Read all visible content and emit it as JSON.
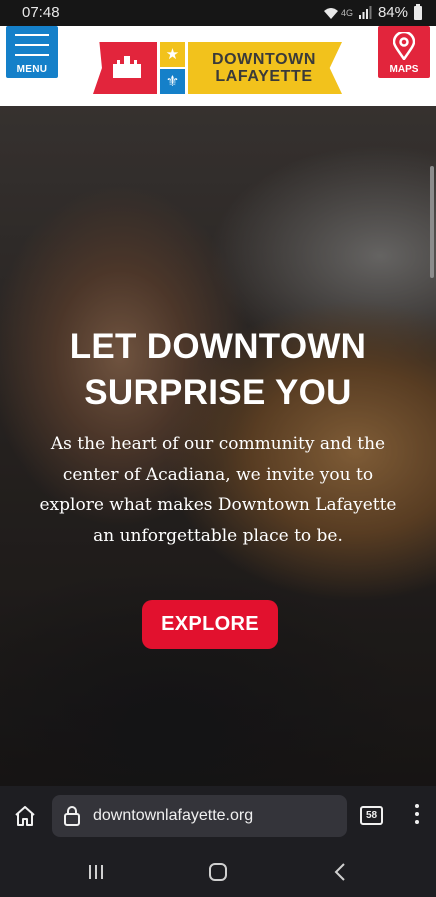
{
  "status_bar": {
    "time": "07:48",
    "network": "4G",
    "battery": "84%"
  },
  "header": {
    "menu_label": "MENU",
    "logo_text_line1": "DOWNTOWN",
    "logo_text_line2": "LAFAYETTE",
    "maps_label": "MAPS",
    "colors": {
      "red": "#e2253c",
      "blue": "#1580c9",
      "yellow": "#f2c21c"
    }
  },
  "hero": {
    "title_line1": "LET DOWNTOWN",
    "title_line2": "SURPRISE YOU",
    "text": "As the heart of our community and the center of Acadiana, we invite you to explore what makes Downtown Lafayette an unforgettable place to be.",
    "button_label": "EXPLORE",
    "button_color": "#e2112e"
  },
  "browser": {
    "url": "downtownlafayette.org",
    "tab_count": "58",
    "icons": [
      "home-icon",
      "lock-icon",
      "tabs-icon",
      "more-vert-icon"
    ]
  },
  "nav": {
    "icons": [
      "recent-apps-icon",
      "home-icon",
      "back-icon"
    ]
  }
}
